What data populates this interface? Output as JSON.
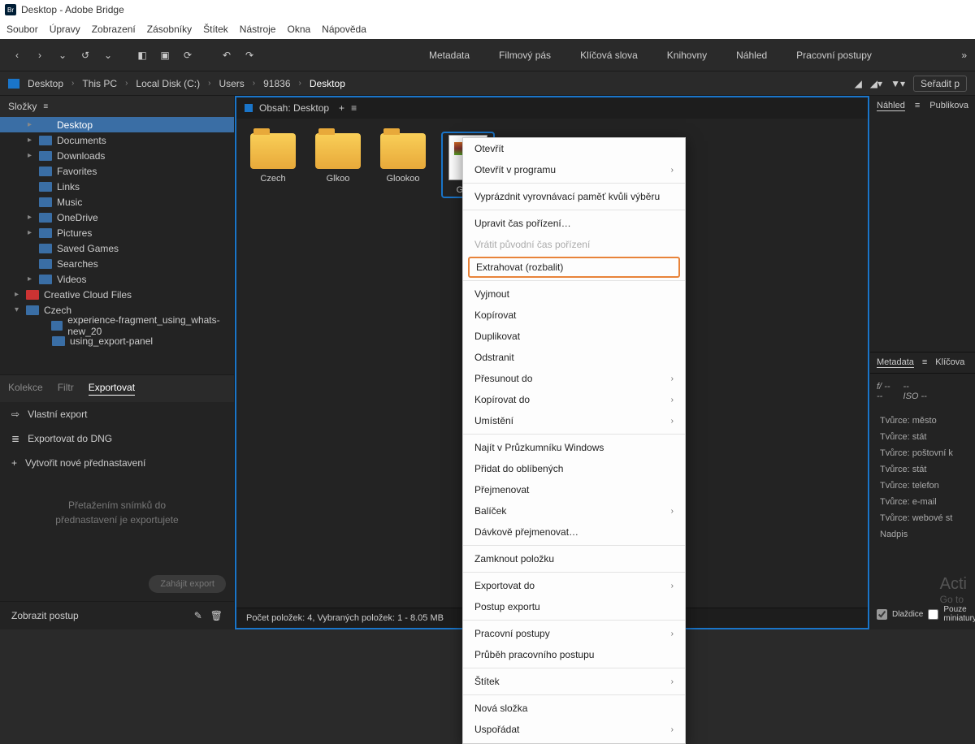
{
  "title": {
    "app": "Desktop - Adobe Bridge"
  },
  "menubar": [
    "Soubor",
    "Úpravy",
    "Zobrazení",
    "Zásobníky",
    "Štítek",
    "Nástroje",
    "Okna",
    "Nápověda"
  ],
  "workspaces": [
    "Metadata",
    "Filmový pás",
    "Klíčová slova",
    "Knihovny",
    "Náhled",
    "Pracovní postupy"
  ],
  "breadcrumb": [
    "Desktop",
    "This PC",
    "Local Disk (C:)",
    "Users",
    "91836",
    "Desktop"
  ],
  "sort_label": "Seřadit p",
  "folders_panel": {
    "title": "Složky"
  },
  "tree": [
    {
      "label": "Desktop",
      "depth": 0,
      "chev": "▸",
      "selected": true
    },
    {
      "label": "Documents",
      "depth": 0,
      "chev": "▸"
    },
    {
      "label": "Downloads",
      "depth": 0,
      "chev": "▸"
    },
    {
      "label": "Favorites",
      "depth": 0,
      "chev": ""
    },
    {
      "label": "Links",
      "depth": 0,
      "chev": ""
    },
    {
      "label": "Music",
      "depth": 0,
      "chev": ""
    },
    {
      "label": "OneDrive",
      "depth": 0,
      "chev": "▸"
    },
    {
      "label": "Pictures",
      "depth": 0,
      "chev": "▸"
    },
    {
      "label": "Saved Games",
      "depth": 0,
      "chev": ""
    },
    {
      "label": "Searches",
      "depth": 0,
      "chev": ""
    },
    {
      "label": "Videos",
      "depth": 0,
      "chev": "▸"
    },
    {
      "label": "Creative Cloud Files",
      "depth": -1,
      "chev": "▸",
      "cc": true
    },
    {
      "label": "Czech",
      "depth": -1,
      "chev": "▾"
    },
    {
      "label": "experience-fragment_using_whats-new_20",
      "depth": 1,
      "chev": ""
    },
    {
      "label": "using_export-panel",
      "depth": 1,
      "chev": ""
    }
  ],
  "left_tabs": {
    "kolekce": "Kolekce",
    "filtr": "Filtr",
    "export": "Exportovat"
  },
  "export": {
    "own": "Vlastní export",
    "dng": "Exportovat do DNG",
    "new_preset": "Vytvořit nové přednastavení",
    "hint1": "Přetažením snímků do",
    "hint2": "přednastavení je exportujete",
    "run": "Zahájit export",
    "show": "Zobrazit postup"
  },
  "content": {
    "header": "Obsah: Desktop",
    "items": [
      {
        "label": "Czech",
        "type": "folder"
      },
      {
        "label": "Glkoo",
        "type": "folder"
      },
      {
        "label": "Glookoo",
        "type": "folder"
      },
      {
        "label": "Glkoo",
        "type": "rar",
        "selected": true
      }
    ],
    "status": "Počet položek: 4, Vybraných položek: 1 - 8.05 MB"
  },
  "right": {
    "tab1": "Náhled",
    "tab2": "Publikova",
    "meta_tab1": "Metadata",
    "meta_tab2": "Klíčova",
    "f_label": "f/",
    "dash": "--",
    "iso": "ISO --",
    "fields": [
      "Tvůrce: město",
      "Tvůrce: stát",
      "Tvůrce: poštovní k",
      "Tvůrce: stát",
      "Tvůrce: telefon",
      "Tvůrce: e-mail",
      "Tvůrce: webové st",
      "Nadpis"
    ],
    "tiles": "Dlaždice",
    "thumbs": "Pouze miniatury",
    "activate": "Acti",
    "goto": "Go to"
  },
  "context_menu": [
    {
      "label": "Otevřít"
    },
    {
      "label": "Otevřít v programu",
      "sub": true
    },
    {
      "sep": true
    },
    {
      "label": "Vyprázdnit vyrovnávací paměť kvůli výběru"
    },
    {
      "sep": true
    },
    {
      "label": "Upravit čas pořízení…"
    },
    {
      "label": "Vrátit původní čas pořízení",
      "disabled": true
    },
    {
      "label": "Extrahovat (rozbalit)",
      "highlight": true
    },
    {
      "sep": true
    },
    {
      "label": "Vyjmout"
    },
    {
      "label": "Kopírovat"
    },
    {
      "label": "Duplikovat"
    },
    {
      "label": "Odstranit"
    },
    {
      "label": "Přesunout do",
      "sub": true
    },
    {
      "label": "Kopírovat do",
      "sub": true
    },
    {
      "label": "Umístění",
      "sub": true
    },
    {
      "sep": true
    },
    {
      "label": "Najít v Průzkumníku Windows"
    },
    {
      "label": "Přidat do oblíbených"
    },
    {
      "label": "Přejmenovat"
    },
    {
      "label": "Balíček",
      "sub": true
    },
    {
      "label": "Dávkově přejmenovat…"
    },
    {
      "sep": true
    },
    {
      "label": "Zamknout položku"
    },
    {
      "sep": true
    },
    {
      "label": "Exportovat do",
      "sub": true
    },
    {
      "label": "Postup exportu"
    },
    {
      "sep": true
    },
    {
      "label": "Pracovní postupy",
      "sub": true
    },
    {
      "label": "Průběh pracovního postupu"
    },
    {
      "sep": true
    },
    {
      "label": "Štítek",
      "sub": true
    },
    {
      "sep": true
    },
    {
      "label": "Nová složka"
    },
    {
      "label": "Uspořádat",
      "sub": true
    }
  ]
}
